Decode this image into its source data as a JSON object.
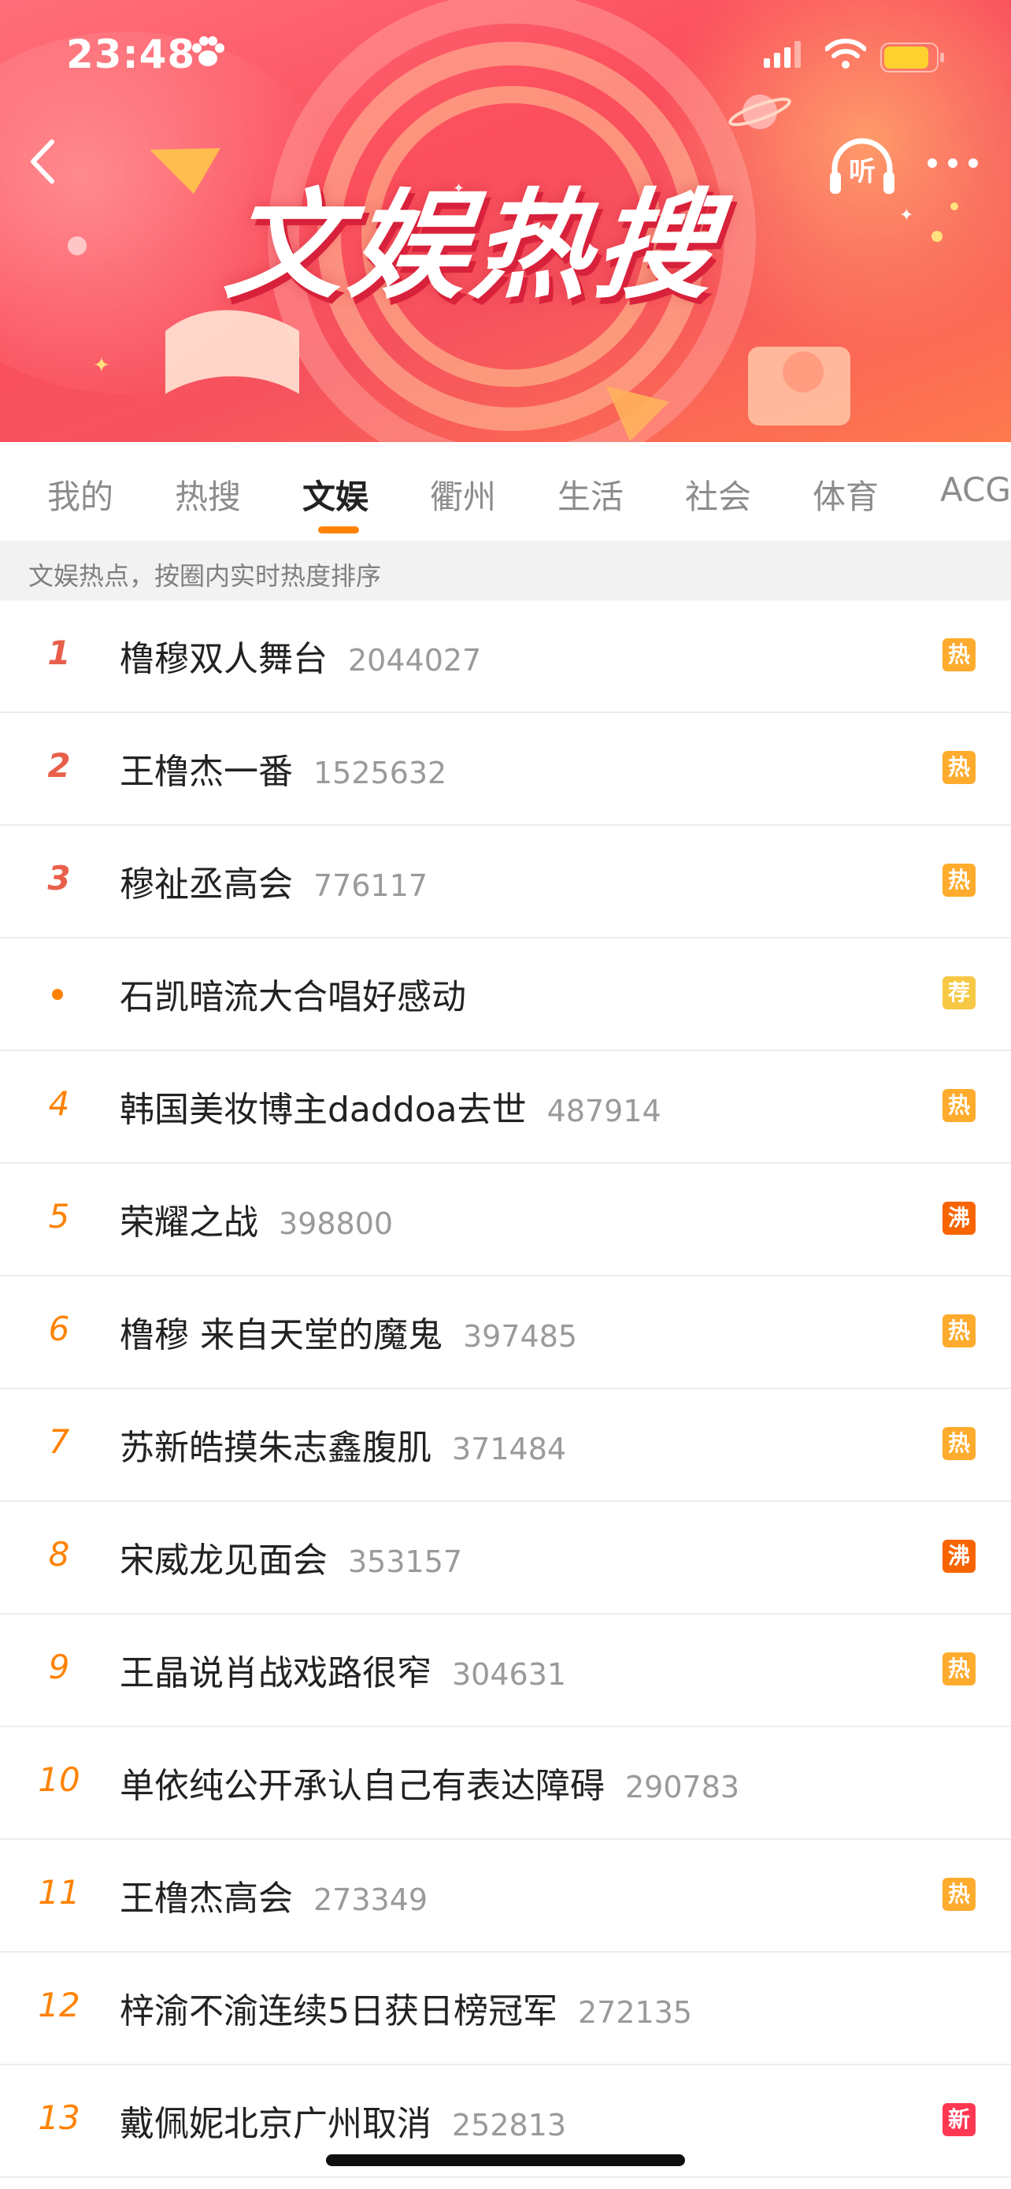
{
  "status_bar": {
    "time": "23:48"
  },
  "header": {
    "title": "文娱热搜",
    "listen_label": "听"
  },
  "tabs": [
    {
      "label": "我的"
    },
    {
      "label": "热搜"
    },
    {
      "label": "文娱"
    },
    {
      "label": "衢州"
    },
    {
      "label": "生活"
    },
    {
      "label": "社会"
    },
    {
      "label": "体育"
    },
    {
      "label": "ACG"
    }
  ],
  "active_tab": "文娱",
  "subheader": {
    "text": "文娱热点，按圈内实时热度排序"
  },
  "items": [
    {
      "rank": "1",
      "title": "橹穆双人舞台",
      "count": "2044027",
      "badge": "热"
    },
    {
      "rank": "2",
      "title": "王橹杰一番",
      "count": "1525632",
      "badge": "热"
    },
    {
      "rank": "3",
      "title": "穆祉丞高会",
      "count": "776117",
      "badge": "热"
    },
    {
      "rank": "",
      "title": "石凯暗流大合唱好感动",
      "count": "",
      "badge": "荐"
    },
    {
      "rank": "4",
      "title": "韩国美妆博主daddoa去世",
      "count": "487914",
      "badge": "热"
    },
    {
      "rank": "5",
      "title": "荣耀之战",
      "count": "398800",
      "badge": "沸"
    },
    {
      "rank": "6",
      "title": "橹穆 来自天堂的魔鬼",
      "count": "397485",
      "badge": "热"
    },
    {
      "rank": "7",
      "title": "苏新皓摸朱志鑫腹肌",
      "count": "371484",
      "badge": "热"
    },
    {
      "rank": "8",
      "title": "宋威龙见面会",
      "count": "353157",
      "badge": "沸"
    },
    {
      "rank": "9",
      "title": "王晶说肖战戏路很窄",
      "count": "304631",
      "badge": "热"
    },
    {
      "rank": "10",
      "title": "单依纯公开承认自己有表达障碍",
      "count": "290783",
      "badge": ""
    },
    {
      "rank": "11",
      "title": "王橹杰高会",
      "count": "273349",
      "badge": "热"
    },
    {
      "rank": "12",
      "title": "梓渝不渝连续5日获日榜冠军",
      "count": "272135",
      "badge": ""
    },
    {
      "rank": "13",
      "title": "戴佩妮北京广州取消",
      "count": "252813",
      "badge": "新"
    }
  ],
  "colors": {
    "accent": "#ff8200",
    "banner": "#fb4f5d",
    "top_rank": "#e8604c"
  }
}
